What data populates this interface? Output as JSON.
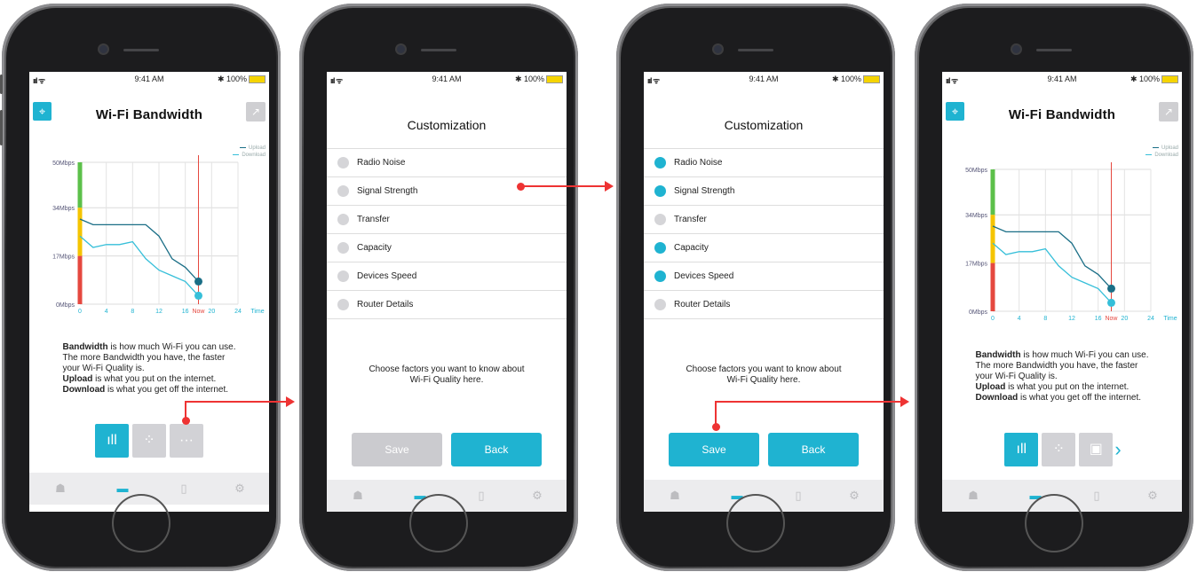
{
  "status": {
    "signal": "ııl ᯤ",
    "time": "9:41 AM",
    "battery": "✱ 100%"
  },
  "colors": {
    "accent": "#1fb3d1",
    "upload": "#1a6e86",
    "download": "#36bfd9",
    "arrow": "#e33333"
  },
  "screen1": {
    "title": "Wi-Fi Bandwidth",
    "legend": {
      "upload": "Upload",
      "download": "Download"
    },
    "chart_data": {
      "type": "line",
      "xlabel": "Time",
      "x_ticks": [
        "0",
        "4",
        "8",
        "12",
        "16",
        "Now",
        "20",
        "24"
      ],
      "y_ticks": [
        "50Mbps",
        "34Mbps",
        "17Mbps",
        "0Mbps"
      ],
      "ylim": [
        0,
        50
      ],
      "xlim": [
        0,
        24
      ],
      "series": [
        {
          "name": "Upload",
          "x": [
            0,
            2,
            4,
            6,
            8,
            10,
            12,
            14,
            16,
            18
          ],
          "y": [
            30,
            28,
            28,
            28,
            28,
            28,
            24,
            16,
            13,
            8
          ]
        },
        {
          "name": "Download",
          "x": [
            0,
            2,
            4,
            6,
            8,
            10,
            12,
            14,
            16,
            18
          ],
          "y": [
            24,
            20,
            21,
            21,
            22,
            16,
            12,
            10,
            8,
            3
          ]
        }
      ],
      "now_x": 18
    },
    "desc": [
      {
        "bold": "Bandwidth",
        "text": " is how much Wi-Fi you can use."
      },
      {
        "bold": "",
        "text": "The more Bandwidth you have, the faster"
      },
      {
        "bold": "",
        "text": "your Wi-Fi Quality is."
      },
      {
        "bold": "Upload",
        "text": " is what you put on the internet."
      },
      {
        "bold": "Download",
        "text": " is what you get off the internet."
      }
    ]
  },
  "screen2": {
    "title": "Customization",
    "items": [
      "Radio Noise",
      "Signal Strength",
      "Transfer",
      "Capacity",
      "Devices Speed",
      "Router Details"
    ],
    "message_line1": "Choose factors you want to know about",
    "message_line2": "Wi-Fi Quality here.",
    "save": "Save",
    "back": "Back"
  },
  "screen3": {
    "title": "Customization",
    "items": [
      "Radio Noise",
      "Signal Strength",
      "Transfer",
      "Capacity",
      "Devices Speed",
      "Router Details"
    ],
    "active": [
      true,
      true,
      false,
      true,
      true,
      false
    ],
    "message_line1": "Choose  factors you want to know about",
    "message_line2": "Wi-Fi Quality here.",
    "save": "Save",
    "back": "Back"
  },
  "screen4": {
    "title": "Wi-Fi Bandwidth"
  }
}
